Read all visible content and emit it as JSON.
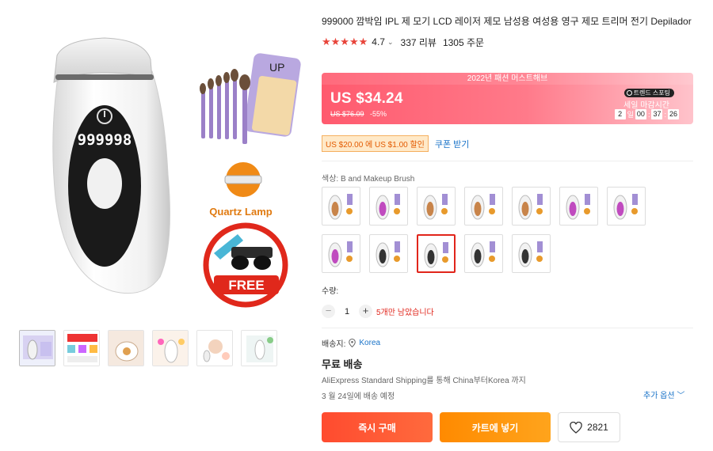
{
  "product": {
    "title": "999000 깜박임 IPL 제 모기 LCD 레이저 제모 남성용 여성용 영구 제모 트리머 전기 Depilador",
    "rating": "4.7",
    "stars": "★★★★★",
    "reviews": "337 리뷰",
    "orders": "1305 주문"
  },
  "gallery": {
    "main_image_text": {
      "display_digits": "999998",
      "quartz_label": "Quartz Lamp",
      "free_label": "FREE",
      "box_label": "UP"
    },
    "thumbnails": [
      "thumb-1",
      "thumb-2",
      "thumb-3",
      "thumb-4",
      "thumb-5",
      "thumb-6"
    ]
  },
  "price": {
    "banner": "2022년 패션 머스트해브",
    "current": "US $34.24",
    "original": "US $76.09",
    "discount": "-55%",
    "trend_badge": "트렌드 스포팅",
    "deadline_label": "세일 마감시간",
    "timer": {
      "days": "2",
      "days_unit": "일",
      "hours": "00",
      "minutes": "37",
      "seconds": "26"
    }
  },
  "coupon": {
    "tag": "US $20.00 에 US $1.00 할인",
    "link": "쿠폰 받기"
  },
  "variant": {
    "label": "색상: B and Makeup Brush",
    "swatches": [
      {
        "color": "#c8844a",
        "selected": false
      },
      {
        "color": "#c04bbf",
        "selected": false
      },
      {
        "color": "#c8844a",
        "selected": false
      },
      {
        "color": "#c8844a",
        "selected": false
      },
      {
        "color": "#c8844a",
        "selected": false
      },
      {
        "color": "#c04bbf",
        "selected": false
      },
      {
        "color": "#c04bbf",
        "selected": false
      },
      {
        "color": "#c04bbf",
        "selected": false
      },
      {
        "color": "#333333",
        "selected": false
      },
      {
        "color": "#333333",
        "selected": true
      },
      {
        "color": "#333333",
        "selected": false
      },
      {
        "color": "#333333",
        "selected": false
      }
    ]
  },
  "quantity": {
    "label": "수량:",
    "minus": "−",
    "value": "1",
    "plus": "+",
    "stock": "5개만 남았습니다"
  },
  "shipping": {
    "to_label": "배송지:",
    "country": "Korea",
    "free": "무료 배송",
    "detail": "AliExpress Standard Shipping를 통해 China부터Korea 까지",
    "date": "3 월 24일에 배송 예정",
    "more": "추가 옵션"
  },
  "actions": {
    "buy": "즉시 구매",
    "cart": "카트에 넣기",
    "wishlist_count": "2821"
  },
  "colors": {
    "accent": "#e1251b",
    "buy": "#ff4b2f",
    "cart": "#ff8a00",
    "link": "#1a73c8"
  }
}
